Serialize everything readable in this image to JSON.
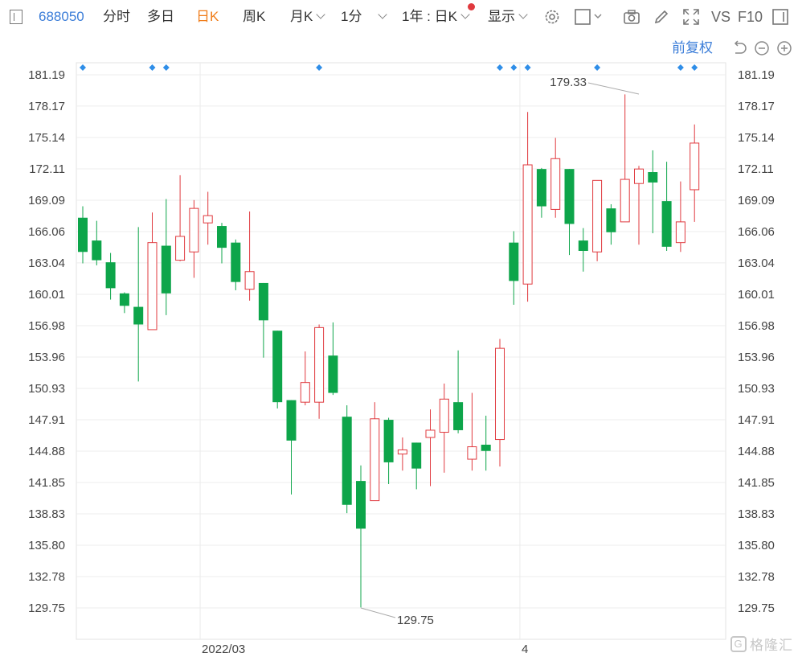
{
  "toolbar": {
    "code": "688050",
    "tabs": [
      "分时",
      "多日",
      "日K",
      "周K",
      "月K",
      "1分"
    ],
    "active_tab": "日K",
    "range_select": "1年 : 日K",
    "display_label": "显示",
    "vs_label": "VS",
    "f10_label": "F10"
  },
  "adjust_label": "前复权",
  "colors": {
    "up": "#e0393e",
    "down": "#0da54a",
    "accent": "#3b7dd8",
    "grid": "#ececec",
    "marker": "#2f8ee8"
  },
  "chart_data": {
    "type": "candlestick",
    "y_ticks": [
      "181.19",
      "178.17",
      "175.14",
      "172.11",
      "169.09",
      "166.06",
      "163.04",
      "160.01",
      "156.98",
      "153.96",
      "150.93",
      "147.91",
      "144.88",
      "141.85",
      "138.83",
      "135.80",
      "132.78",
      "129.75"
    ],
    "ylim": [
      129.75,
      181.19
    ],
    "x_labels": [
      {
        "index": 9,
        "label": "2022/03"
      },
      {
        "index": 32,
        "label": "4"
      }
    ],
    "max_annotation": {
      "index": 40,
      "value": "179.33"
    },
    "min_annotation": {
      "index": 20,
      "value": "129.75"
    },
    "event_markers": [
      0,
      5,
      6,
      17,
      30,
      31,
      32,
      37,
      43,
      44
    ],
    "candles": [
      {
        "o": 167.4,
        "h": 168.5,
        "l": 163.0,
        "c": 164.1
      },
      {
        "o": 165.2,
        "h": 167.1,
        "l": 162.8,
        "c": 163.3
      },
      {
        "o": 163.1,
        "h": 164.0,
        "l": 159.5,
        "c": 160.6
      },
      {
        "o": 160.1,
        "h": 160.2,
        "l": 158.2,
        "c": 158.9
      },
      {
        "o": 158.8,
        "h": 166.5,
        "l": 151.6,
        "c": 157.1
      },
      {
        "o": 156.6,
        "h": 167.9,
        "l": 156.6,
        "c": 165.0
      },
      {
        "o": 164.7,
        "h": 169.2,
        "l": 158.0,
        "c": 160.1
      },
      {
        "o": 163.3,
        "h": 171.5,
        "l": 163.2,
        "c": 165.6
      },
      {
        "o": 164.1,
        "h": 169.1,
        "l": 161.6,
        "c": 168.3
      },
      {
        "o": 166.9,
        "h": 169.9,
        "l": 164.8,
        "c": 167.6
      },
      {
        "o": 166.6,
        "h": 166.9,
        "l": 163.0,
        "c": 164.5
      },
      {
        "o": 165.0,
        "h": 165.3,
        "l": 160.4,
        "c": 161.2
      },
      {
        "o": 160.5,
        "h": 168.0,
        "l": 159.4,
        "c": 162.2
      },
      {
        "o": 161.1,
        "h": 161.1,
        "l": 153.9,
        "c": 157.5
      },
      {
        "o": 156.5,
        "h": 156.5,
        "l": 149.0,
        "c": 149.6
      },
      {
        "o": 149.8,
        "h": 149.8,
        "l": 140.7,
        "c": 145.9
      },
      {
        "o": 149.6,
        "h": 154.5,
        "l": 149.3,
        "c": 151.5
      },
      {
        "o": 149.6,
        "h": 157.1,
        "l": 148.0,
        "c": 156.8
      },
      {
        "o": 154.1,
        "h": 157.3,
        "l": 150.3,
        "c": 150.5
      },
      {
        "o": 148.2,
        "h": 149.3,
        "l": 138.9,
        "c": 139.7
      },
      {
        "o": 142.0,
        "h": 143.5,
        "l": 129.8,
        "c": 137.4
      },
      {
        "o": 140.1,
        "h": 149.6,
        "l": 140.1,
        "c": 148.0
      },
      {
        "o": 147.9,
        "h": 148.1,
        "l": 141.7,
        "c": 143.8
      },
      {
        "o": 144.6,
        "h": 146.2,
        "l": 143.0,
        "c": 145.0
      },
      {
        "o": 145.7,
        "h": 145.7,
        "l": 141.2,
        "c": 143.2
      },
      {
        "o": 146.2,
        "h": 148.9,
        "l": 141.5,
        "c": 146.9
      },
      {
        "o": 146.7,
        "h": 151.4,
        "l": 142.8,
        "c": 149.9
      },
      {
        "o": 149.6,
        "h": 154.6,
        "l": 146.6,
        "c": 146.9
      },
      {
        "o": 144.1,
        "h": 150.5,
        "l": 143.0,
        "c": 145.3
      },
      {
        "o": 145.5,
        "h": 148.3,
        "l": 143.0,
        "c": 144.9
      },
      {
        "o": 146.0,
        "h": 155.7,
        "l": 143.4,
        "c": 154.8
      },
      {
        "o": 165.0,
        "h": 166.1,
        "l": 159.0,
        "c": 161.3
      },
      {
        "o": 161.0,
        "h": 177.6,
        "l": 159.3,
        "c": 172.5
      },
      {
        "o": 172.1,
        "h": 172.2,
        "l": 167.4,
        "c": 168.5
      },
      {
        "o": 168.2,
        "h": 175.1,
        "l": 167.4,
        "c": 173.1
      },
      {
        "o": 172.1,
        "h": 172.1,
        "l": 163.8,
        "c": 166.8
      },
      {
        "o": 165.2,
        "h": 166.4,
        "l": 162.2,
        "c": 164.2
      },
      {
        "o": 164.1,
        "h": 171.0,
        "l": 163.2,
        "c": 171.0
      },
      {
        "o": 168.3,
        "h": 168.7,
        "l": 164.8,
        "c": 166.0
      },
      {
        "o": 167.0,
        "h": 179.3,
        "l": 167.0,
        "c": 171.1
      },
      {
        "o": 170.7,
        "h": 172.4,
        "l": 164.8,
        "c": 172.1
      },
      {
        "o": 171.8,
        "h": 173.9,
        "l": 165.9,
        "c": 170.8
      },
      {
        "o": 169.0,
        "h": 172.8,
        "l": 164.2,
        "c": 164.6
      },
      {
        "o": 165.0,
        "h": 170.9,
        "l": 164.1,
        "c": 167.0
      },
      {
        "o": 170.1,
        "h": 176.4,
        "l": 167.0,
        "c": 174.6
      }
    ]
  }
}
